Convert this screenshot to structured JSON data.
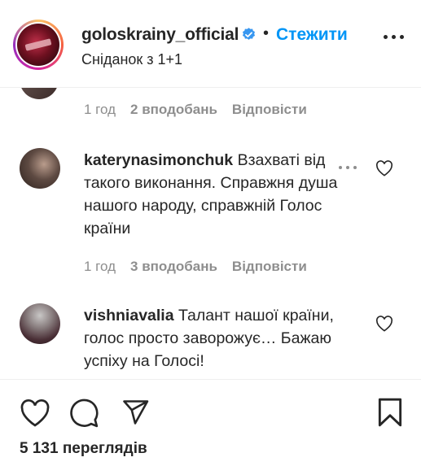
{
  "header": {
    "username": "goloskrainy_official",
    "follow_label": "Стежити",
    "subtitle": "Сніданок з 1+1",
    "separator": "•"
  },
  "comments": [
    {
      "user": "",
      "text": "",
      "time": "1 год",
      "likes": "2 вподобань",
      "reply": "Відповісти"
    },
    {
      "user": "katerynasimonchuk",
      "text": "Взахваті від такого виконання. Справжня душа нашого народу, справжній Голос країни",
      "time": "1 год",
      "likes": "3 вподобань",
      "reply": "Відповісти"
    },
    {
      "user": "vishniavalia",
      "text": "Талант нашої країни, голос просто заворожує… Бажаю успіху на Голосі!",
      "time": "",
      "likes": "",
      "reply": ""
    }
  ],
  "footer": {
    "views": "5 131 переглядів"
  },
  "icons": {
    "verified": "verified-badge-icon",
    "more": "more-options-icon",
    "like": "heart-icon",
    "comment": "comment-bubble-icon",
    "share": "paper-plane-icon",
    "save": "bookmark-icon"
  },
  "colors": {
    "link_blue": "#0095f6",
    "text": "#262626",
    "muted": "#8e8e8e"
  }
}
